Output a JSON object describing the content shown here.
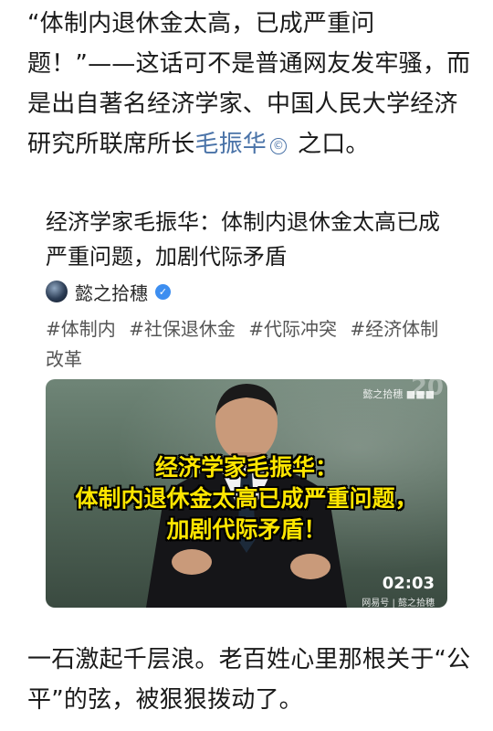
{
  "post": {
    "intro_before_mention": "“体制内退休金太高，已成严重问题！”——这话可不是普通网友发牢骚，而是出自著名经济学家、中国人民大学经济研究所联席所长",
    "mention_name": "毛振华",
    "mention_icon": "©",
    "intro_after_mention": "之口。",
    "outro": "一石激起千层浪。老百姓心里那根关于“公平”的弦，被狠狠拨动了。"
  },
  "card": {
    "title": "经济学家毛振华：体制内退休金太高已成严重问题，加剧代际矛盾",
    "author": "懿之拾穗",
    "verified_icon": "✓",
    "tags": [
      "#体制内",
      "#社保退休金",
      "#代际冲突",
      "#经济体制改革"
    ],
    "video": {
      "caption_lines": [
        "经济学家毛振华：",
        "体制内退休金太高已成严重问题，",
        "加剧代际矛盾！"
      ],
      "watermark_top": "懿之拾穗 ■■■",
      "watermark_corner": "20",
      "duration": "02:03",
      "watermark_bottom": "网易号 | 懿之拾穗"
    }
  },
  "colors": {
    "mention": "#4a73a8",
    "caption": "#ffe600",
    "verified": "#3d8ef0"
  }
}
